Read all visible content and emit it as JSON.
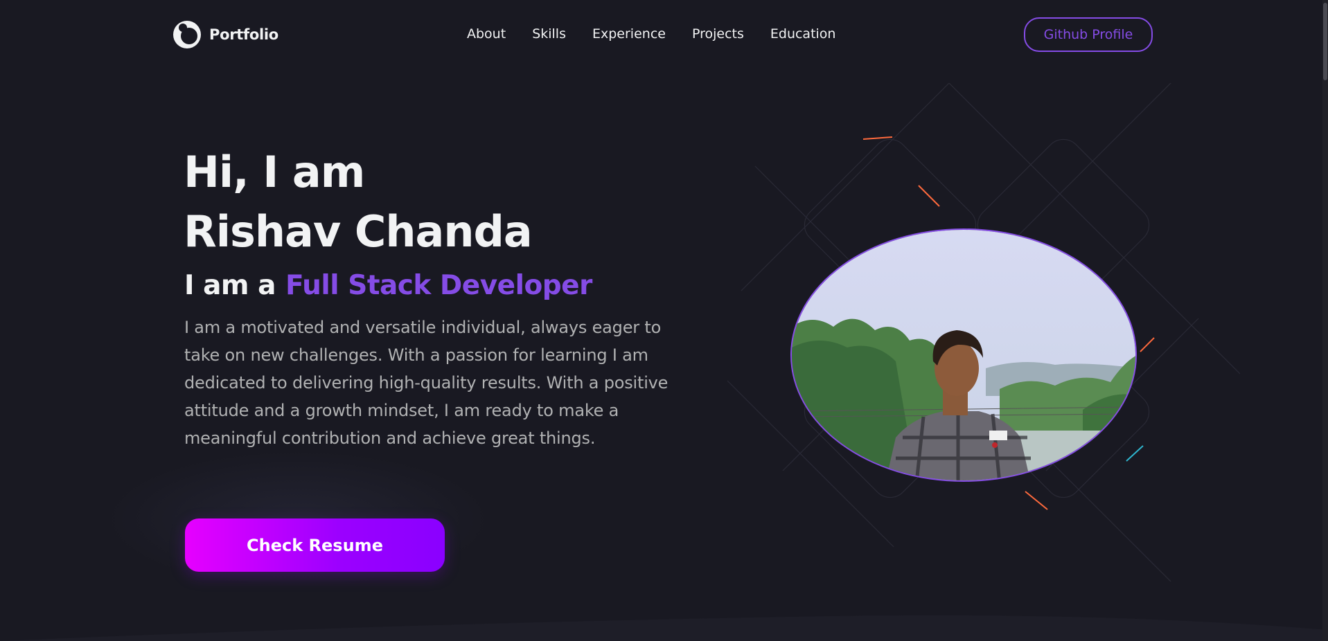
{
  "nav": {
    "brand": "Portfolio",
    "links": [
      "About",
      "Skills",
      "Experience",
      "Projects",
      "Education"
    ],
    "github_label": "Github Profile"
  },
  "hero": {
    "greeting": "Hi, I am",
    "name": "Rishav Chanda",
    "role_prefix": "I am a",
    "role": "Full Stack Developer",
    "bio": "I am a motivated and versatile individual, always eager to take on new challenges. With a passion for learning I am dedicated to delivering high-quality results. With a positive attitude and a growth mindset, I am ready to make a meaningful contribution and achieve great things.",
    "resume_label": "Check Resume"
  },
  "colors": {
    "background": "#191922",
    "accent": "#854ce6",
    "text_primary": "#f2f3f4",
    "text_secondary": "#b1b2b3",
    "button_gradient_start": "#e600ff",
    "button_gradient_end": "#8a00ff"
  },
  "icons": {
    "brand_logo": "portfolio-logo-icon",
    "avatar": "profile-photo"
  }
}
